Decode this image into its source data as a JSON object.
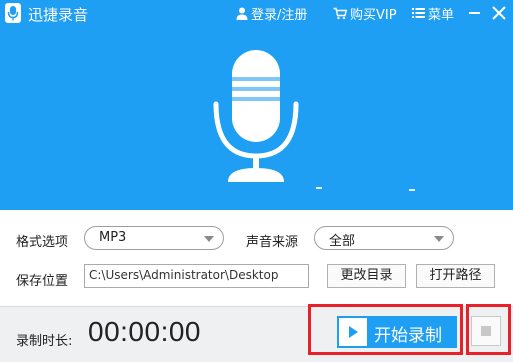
{
  "app": {
    "title": "迅捷录音",
    "accent": "#1f9ff4",
    "highlight": "#e8202a"
  },
  "titlebar": {
    "login": "登录/注册",
    "vip": "购买VIP",
    "menu": "菜单",
    "icons": [
      "user-icon",
      "cart-icon",
      "menu-lines-icon",
      "minimize-icon",
      "close-icon"
    ]
  },
  "settings": {
    "format_label": "格式选项",
    "format_value": "MP3",
    "source_label": "声音来源",
    "source_value": "全部",
    "save_label": "保存位置",
    "save_path": "C:\\Users\\Administrator\\Desktop",
    "change_dir": "更改目录",
    "open_path": "打开路径"
  },
  "recording": {
    "duration_label": "录制时长:",
    "timer": "00:00:00",
    "start_label": "开始录制"
  }
}
